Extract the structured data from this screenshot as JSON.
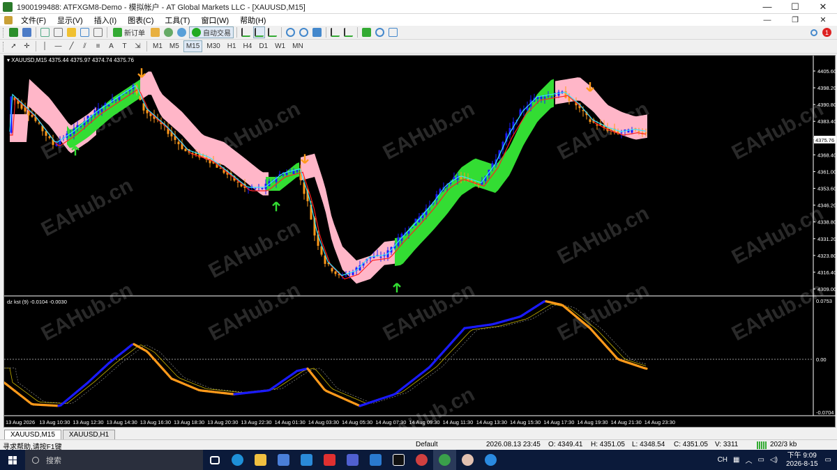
{
  "window": {
    "title": "1900199488: ATFXGM8-Demo - 模拟帐户 - AT Global Markets LLC - [XAUUSD,M15]",
    "min": "—",
    "max": "☐",
    "close": "✕"
  },
  "menu": [
    "文件(F)",
    "显示(V)",
    "插入(I)",
    "图表(C)",
    "工具(T)",
    "窗口(W)",
    "帮助(H)"
  ],
  "toolbar": {
    "new_order": "新订单",
    "auto_trading": "自动交易",
    "timeframes": [
      "M1",
      "M5",
      "M15",
      "M30",
      "H1",
      "H4",
      "D1",
      "W1",
      "MN"
    ],
    "active_timeframe": "M15",
    "notification_count": "1"
  },
  "chart": {
    "info": "XAUUSD,M15  4375.44 4375.97 4374.74 4375.76",
    "current_price": "4375.76",
    "price_ticks": [
      "4405.60",
      "4398.20",
      "4390.80",
      "4383.40",
      "4376.00",
      "4368.40",
      "4361.00",
      "4353.60",
      "4346.20",
      "4338.80",
      "4331.20",
      "4323.80",
      "4316.40",
      "4309.00"
    ],
    "indicator_label": "dz kst (9) -0.0104 -0.0030",
    "indicator_ticks": [
      "0.0753",
      "0.00",
      "-0.0704"
    ],
    "time_ticks": [
      "13 Aug 2026",
      "13 Aug 10:30",
      "13 Aug 12:30",
      "13 Aug 14:30",
      "13 Aug 16:30",
      "13 Aug 18:30",
      "13 Aug 20:30",
      "13 Aug 22:30",
      "14 Aug 01:30",
      "14 Aug 03:30",
      "14 Aug 05:30",
      "14 Aug 07:30",
      "14 Aug 09:30",
      "14 Aug 11:30",
      "14 Aug 13:30",
      "14 Aug 15:30",
      "14 Aug 17:30",
      "14 Aug 19:30",
      "14 Aug 21:30",
      "14 Aug 23:30"
    ],
    "watermark": "EAHub.cn",
    "colors": {
      "bull": "#1a1aff",
      "bear": "#ff9a1a",
      "band_up": "#33dd33",
      "band_down": "#ffb6c8",
      "fast_line": "#33e6ff",
      "slow_line": "#ff2020"
    }
  },
  "tabs": [
    "XAUUSD,M15",
    "XAUUSD,H1"
  ],
  "status": {
    "help": "寻求帮助,请按F1键",
    "profile": "Default",
    "datetime": "2026.08.13 23:45",
    "open": "O: 4349.41",
    "high": "H: 4351.05",
    "low": "L: 4348.54",
    "close": "C: 4351.05",
    "volume": "V: 3311",
    "traffic": "202/3 kb"
  },
  "taskbar": {
    "search": "搜索",
    "ime": "CH",
    "time": "下午 9:09",
    "date": "2026-8-15"
  }
}
